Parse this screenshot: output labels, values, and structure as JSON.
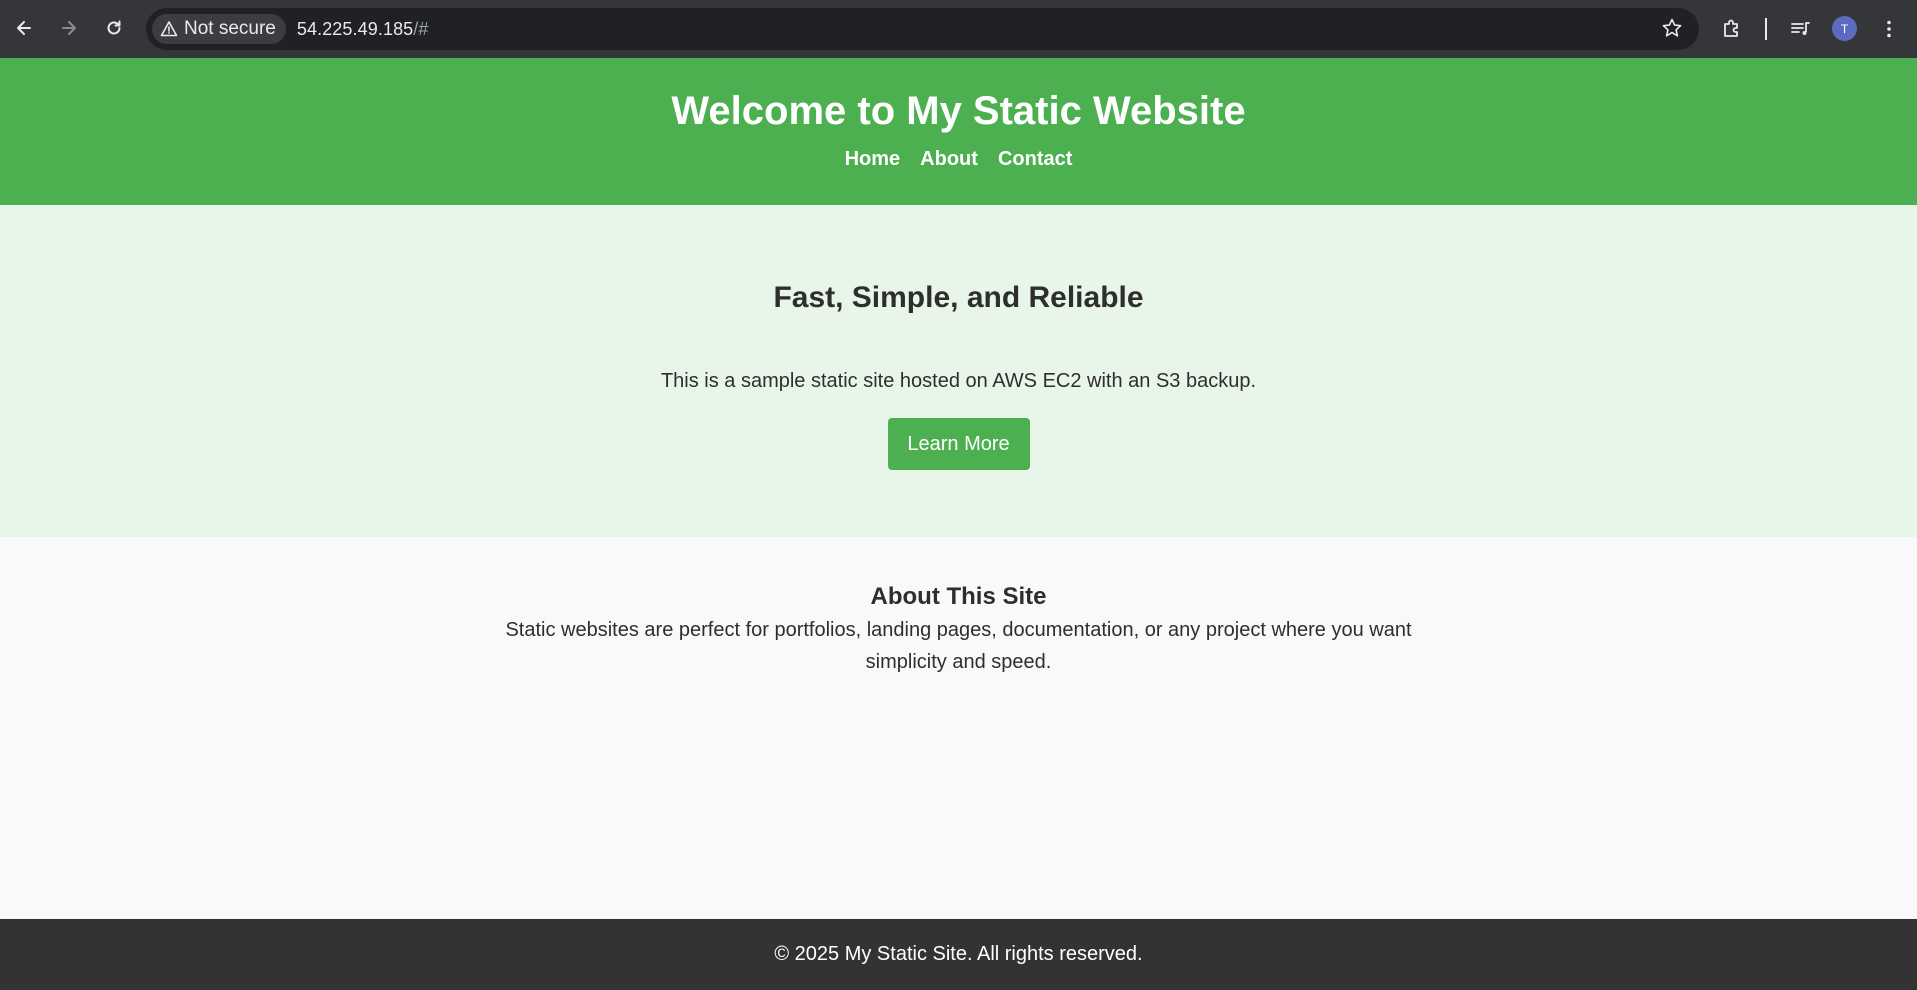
{
  "browser": {
    "security_label": "Not secure",
    "url_host": "54.225.49.185",
    "url_fragment": "/#",
    "profile_initial": "T",
    "icons": [
      "back-icon",
      "forward-icon",
      "reload-icon",
      "warning-icon",
      "star-icon",
      "extensions-icon",
      "media-icon",
      "menu-icon"
    ]
  },
  "header": {
    "title": "Welcome to My Static Website",
    "nav": [
      "Home",
      "About",
      "Contact"
    ]
  },
  "hero": {
    "heading": "Fast, Simple, and Reliable",
    "text": "This is a sample static site hosted on AWS EC2 with an S3 backup.",
    "button_label": "Learn More"
  },
  "about": {
    "heading": "About This Site",
    "text": "Static websites are perfect for portfolios, landing pages, documentation, or any project where you want simplicity and speed."
  },
  "footer": {
    "text": "© 2025 My Static Site. All rights reserved."
  },
  "colors": {
    "brand_green": "#4caf50",
    "hero_bg": "#e8f5e9",
    "footer_bg": "#333333",
    "chrome_bg": "#35363a"
  }
}
